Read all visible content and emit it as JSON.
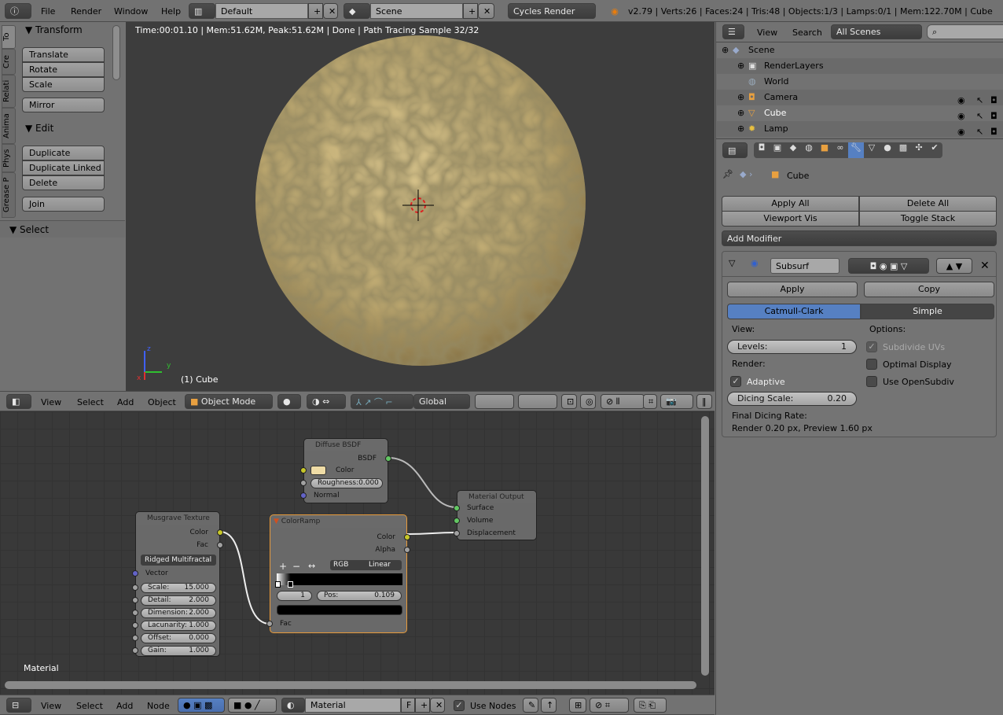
{
  "topbar": {
    "menus": [
      "File",
      "Render",
      "Window",
      "Help"
    ],
    "screen_layout": "Default",
    "scene": "Scene",
    "engine": "Cycles Render",
    "stats": "v2.79 | Verts:26 | Faces:24 | Tris:48 | Objects:1/3 | Lamps:0/1 | Mem:122.70M | Cube"
  },
  "toolshelf": {
    "tabs": [
      "To",
      "Cre",
      "Relati",
      "Anima",
      "Phys",
      "Grease P"
    ],
    "transform_title": "Transform",
    "transform_buttons": [
      "Translate",
      "Rotate",
      "Scale"
    ],
    "mirror": "Mirror",
    "edit_title": "Edit",
    "edit_buttons": [
      "Duplicate",
      "Duplicate Linked",
      "Delete"
    ],
    "join": "Join",
    "select_title": "Select"
  },
  "viewport": {
    "render_status": "Time:00:01.10 | Mem:51.62M, Peak:51.62M | Done | Path Tracing Sample 32/32",
    "object_label": "(1) Cube",
    "axes": [
      "z",
      "y",
      "x"
    ]
  },
  "view3d_header": {
    "menus": [
      "View",
      "Select",
      "Add",
      "Object"
    ],
    "mode": "Object Mode",
    "orientation": "Global"
  },
  "node_editor": {
    "label": "Material",
    "diffuse": {
      "title": "Diffuse BSDF",
      "out": "BSDF",
      "color": "Color",
      "roughness_label": "Roughness:",
      "roughness": "0.000",
      "normal": "Normal",
      "swatch": "#efdca6"
    },
    "output": {
      "title": "Material Output",
      "inputs": [
        "Surface",
        "Volume",
        "Displacement"
      ]
    },
    "musgrave": {
      "title": "Musgrave Texture",
      "outputs": [
        "Color",
        "Fac"
      ],
      "type": "Ridged Multifractal",
      "vector": "Vector",
      "fields": [
        {
          "label": "Scale:",
          "value": "15.000"
        },
        {
          "label": "Detail:",
          "value": "2.000"
        },
        {
          "label": "Dimension:",
          "value": "2.000"
        },
        {
          "label": "Lacunarity:",
          "value": "1.000"
        },
        {
          "label": "Offset:",
          "value": "0.000"
        },
        {
          "label": "Gain:",
          "value": "1.000"
        }
      ]
    },
    "colorramp": {
      "title": "ColorRamp",
      "outputs": [
        "Color",
        "Alpha"
      ],
      "plus": "+",
      "minus": "−",
      "flip": "↔",
      "mode": "RGB",
      "interp": "Linear",
      "index": "1",
      "pos_label": "Pos:",
      "pos": "0.109",
      "input": "Fac"
    }
  },
  "node_header": {
    "menus": [
      "View",
      "Select",
      "Add",
      "Node"
    ],
    "material": "Material",
    "fake_user": "F",
    "use_nodes": "Use Nodes"
  },
  "outliner": {
    "menus": [
      "View",
      "Search"
    ],
    "filter": "All Scenes",
    "items": [
      "Scene",
      "RenderLayers",
      "World",
      "Camera",
      "Cube",
      "Lamp"
    ]
  },
  "properties": {
    "breadcrumb": "Cube",
    "apply_all": "Apply All",
    "delete_all": "Delete All",
    "viewport_vis": "Viewport Vis",
    "toggle_stack": "Toggle Stack",
    "add_modifier": "Add Modifier",
    "modifier": {
      "name": "Subsurf",
      "apply": "Apply",
      "copy": "Copy",
      "catmull": "Catmull-Clark",
      "simple": "Simple",
      "view_label": "View:",
      "levels_label": "Levels:",
      "levels": "1",
      "render_label": "Render:",
      "adaptive": "Adaptive",
      "dicing_label": "Dicing Scale:",
      "dicing": "0.20",
      "final_rate_label": "Final Dicing Rate:",
      "final_rate": "Render 0.20 px, Preview 1.60 px",
      "options_label": "Options:",
      "subdivide_uvs": "Subdivide UVs",
      "optimal_display": "Optimal Display",
      "use_opensubdiv": "Use OpenSubdiv"
    }
  },
  "colors": {
    "accent": "#5680c2",
    "selected_node": "#e89b3a",
    "socket_color": "#c7c729",
    "socket_shader": "#63c763",
    "socket_vector": "#6363c7"
  }
}
